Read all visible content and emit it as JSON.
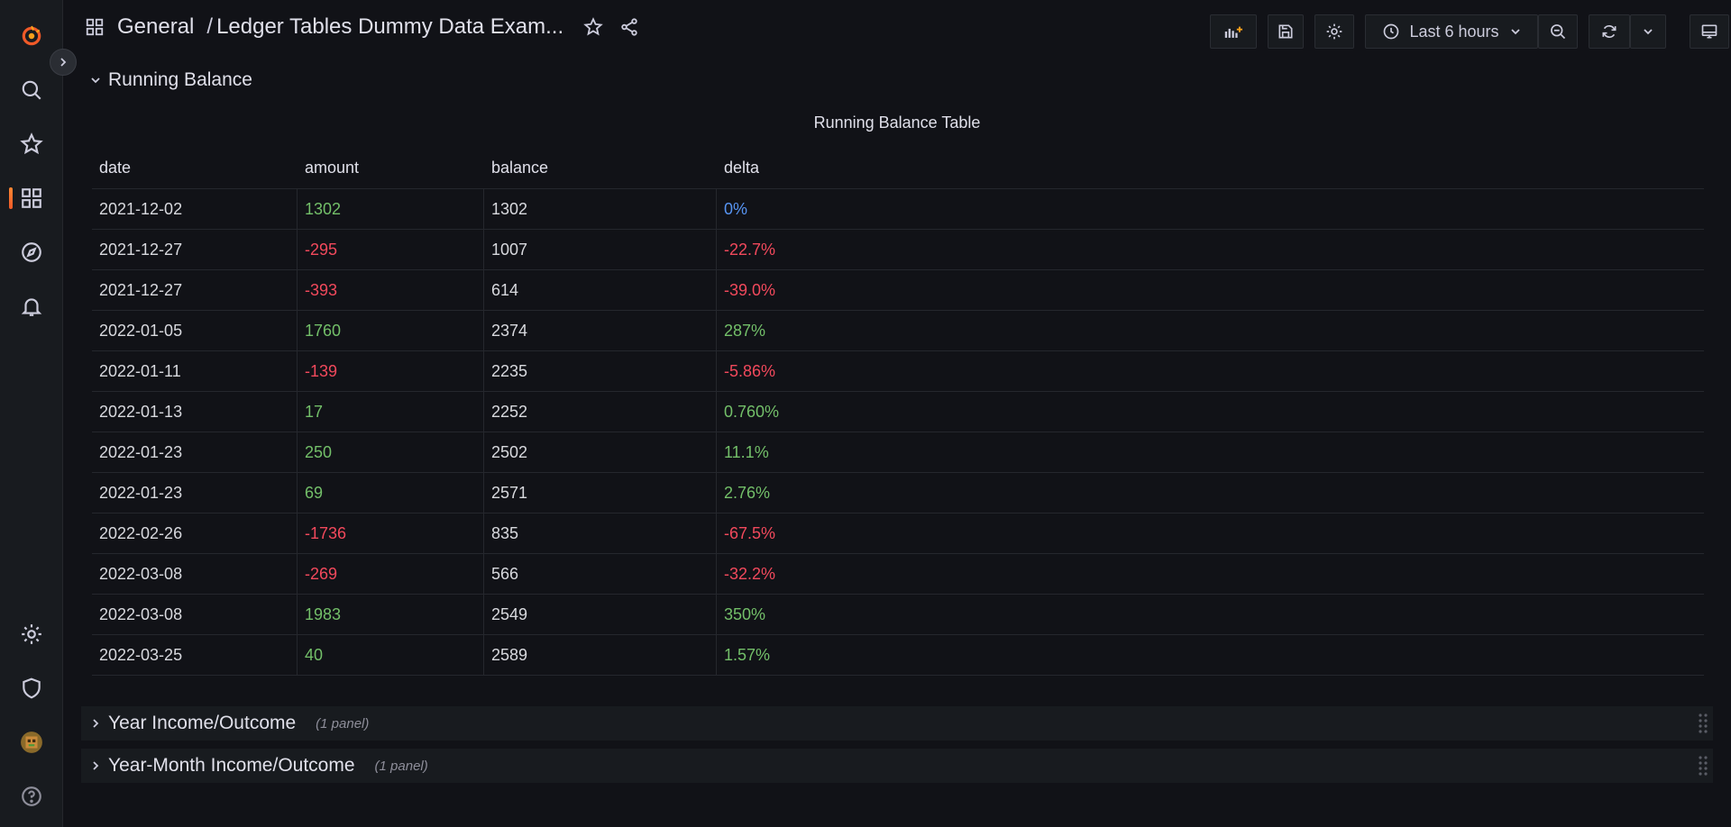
{
  "breadcrumb": {
    "folder": "General",
    "separator": "/",
    "dashboard": "Ledger Tables Dummy Data Exam..."
  },
  "time_picker": {
    "label": "Last 6 hours"
  },
  "rows": {
    "running_balance": {
      "title": "Running Balance"
    },
    "year": {
      "title": "Year Income/Outcome",
      "count": "(1 panel)"
    },
    "year_month": {
      "title": "Year-Month Income/Outcome",
      "count": "(1 panel)"
    }
  },
  "panel": {
    "title": "Running Balance Table",
    "columns": [
      "date",
      "amount",
      "balance",
      "delta"
    ],
    "rows": [
      [
        "2021-12-02",
        "1302",
        "1302",
        "0%"
      ],
      [
        "2021-12-27",
        "-295",
        "1007",
        "-22.7%"
      ],
      [
        "2021-12-27",
        "-393",
        "614",
        "-39.0%"
      ],
      [
        "2022-01-05",
        "1760",
        "2374",
        "287%"
      ],
      [
        "2022-01-11",
        "-139",
        "2235",
        "-5.86%"
      ],
      [
        "2022-01-13",
        "17",
        "2252",
        "0.760%"
      ],
      [
        "2022-01-23",
        "250",
        "2502",
        "11.1%"
      ],
      [
        "2022-01-23",
        "69",
        "2571",
        "2.76%"
      ],
      [
        "2022-02-26",
        "-1736",
        "835",
        "-67.5%"
      ],
      [
        "2022-03-08",
        "-269",
        "566",
        "-32.2%"
      ],
      [
        "2022-03-08",
        "1983",
        "2549",
        "350%"
      ],
      [
        "2022-03-25",
        "40",
        "2589",
        "1.57%"
      ]
    ]
  },
  "colors": {
    "positive": "#73bf69",
    "negative": "#f2495c",
    "neutral": "#5794f2",
    "accent": "#f05a28"
  }
}
